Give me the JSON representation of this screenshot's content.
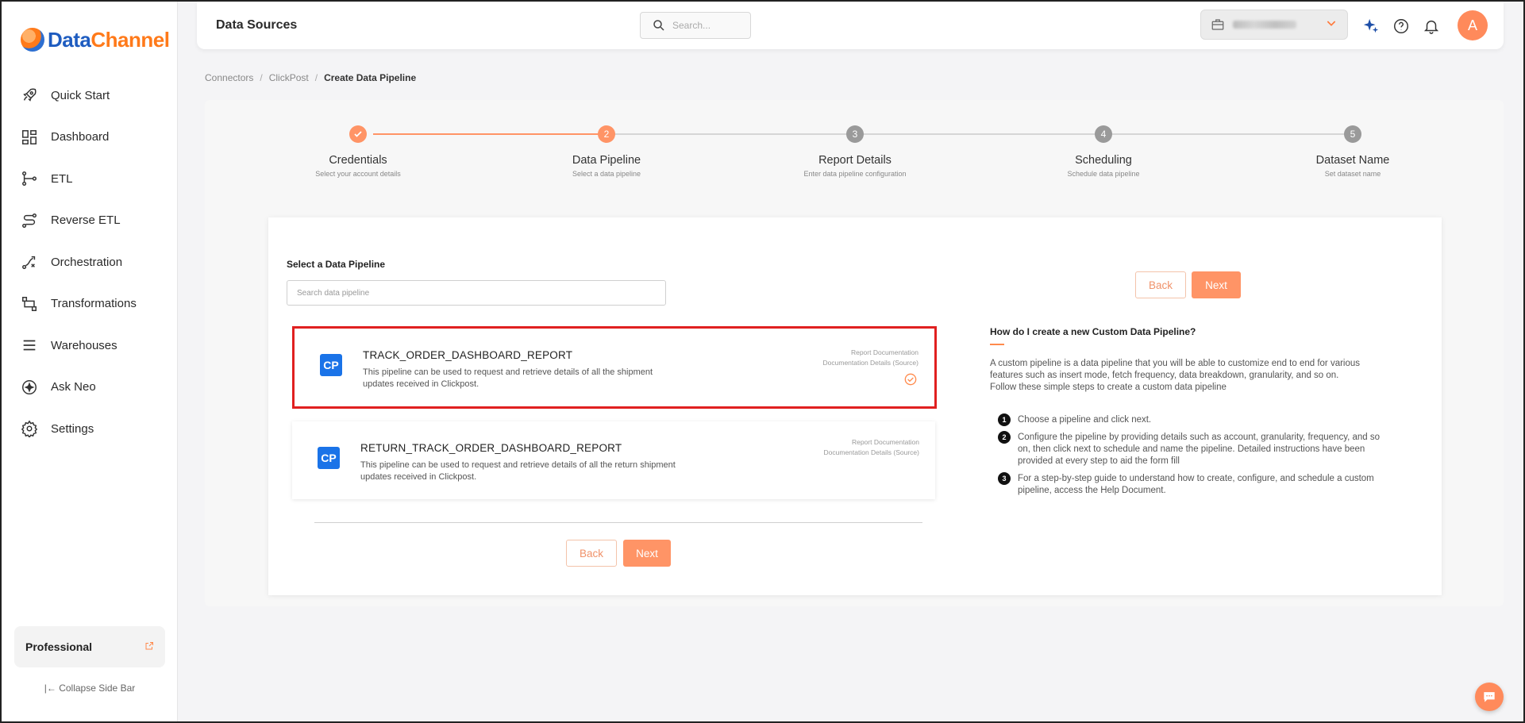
{
  "brand": {
    "part1": "Data",
    "part2": "Channel"
  },
  "sidebar": {
    "items": [
      {
        "label": "Quick Start",
        "icon": "rocket-icon"
      },
      {
        "label": "Dashboard",
        "icon": "dashboard-icon"
      },
      {
        "label": "ETL",
        "icon": "etl-icon"
      },
      {
        "label": "Reverse ETL",
        "icon": "reverse-etl-icon"
      },
      {
        "label": "Orchestration",
        "icon": "orchestration-icon"
      },
      {
        "label": "Transformations",
        "icon": "transformations-icon"
      },
      {
        "label": "Warehouses",
        "icon": "warehouses-icon"
      },
      {
        "label": "Ask Neo",
        "icon": "ask-neo-icon"
      },
      {
        "label": "Settings",
        "icon": "settings-gear-icon"
      }
    ],
    "plan_label": "Professional",
    "collapse_label": "Collapse Side Bar"
  },
  "header": {
    "title": "Data Sources",
    "search_placeholder": "Search...",
    "avatar_initial": "A"
  },
  "breadcrumb": {
    "items": [
      "Connectors",
      "ClickPost"
    ],
    "current": "Create Data Pipeline"
  },
  "stepper": {
    "steps": [
      {
        "number": "1",
        "name": "Credentials",
        "sub": "Select your account details",
        "state": "done"
      },
      {
        "number": "2",
        "name": "Data Pipeline",
        "sub": "Select a data pipeline",
        "state": "active"
      },
      {
        "number": "3",
        "name": "Report Details",
        "sub": "Enter data pipeline configuration",
        "state": "pending"
      },
      {
        "number": "4",
        "name": "Scheduling",
        "sub": "Schedule data pipeline",
        "state": "pending"
      },
      {
        "number": "5",
        "name": "Dataset Name",
        "sub": "Set dataset name",
        "state": "pending"
      }
    ]
  },
  "main": {
    "select_label": "Select a Data Pipeline",
    "search_placeholder": "Search data pipeline",
    "pipelines": [
      {
        "badge": "CP",
        "name": "TRACK_ORDER_DASHBOARD_REPORT",
        "desc": "This pipeline can be used to request and retrieve details of all the shipment updates received in Clickpost.",
        "link1": "Report Documentation",
        "link2": "Documentation Details (Source)",
        "selected": true
      },
      {
        "badge": "CP",
        "name": "RETURN_TRACK_ORDER_DASHBOARD_REPORT",
        "desc": "This pipeline can be used to request and retrieve details of all the return shipment updates received in Clickpost.",
        "link1": "Report Documentation",
        "link2": "Documentation Details (Source)",
        "selected": false
      }
    ],
    "back_label": "Back",
    "next_label": "Next"
  },
  "help": {
    "title": "How do I create a new Custom Data Pipeline?",
    "intro": "A custom pipeline is a data pipeline that you will be able to customize end to end for various features such as insert mode, fetch frequency, data breakdown, granularity, and so on.",
    "intro2": "Follow these simple steps to create a custom data pipeline",
    "steps": [
      {
        "num": "1",
        "text": "Choose a pipeline and click next."
      },
      {
        "num": "2",
        "text": "Configure the pipeline by providing details such as account, granularity, frequency, and so on, then click next to schedule and name the pipeline. Detailed instructions have been provided at every step to aid the form fill"
      },
      {
        "num": "3",
        "text": "For a step-by-step guide to understand how to create, configure, and schedule a custom pipeline, access the Help Document."
      }
    ]
  },
  "colors": {
    "accent": "#ff9466",
    "done": "#ff9466",
    "pending": "#9a9a9a",
    "selected_border": "#e02020",
    "badge": "#1a73e8"
  }
}
